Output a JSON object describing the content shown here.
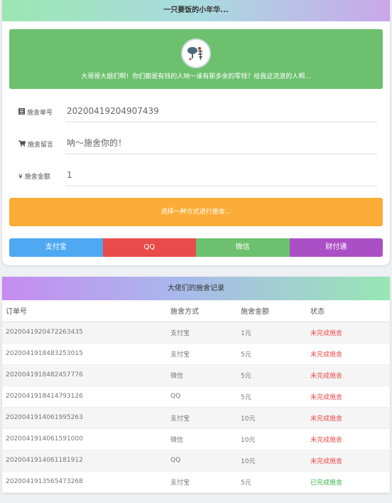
{
  "header": {
    "title": "一只要饭的小年华..."
  },
  "banner": {
    "avatar_icon": "nianhua-logo",
    "text": "大哥哥大姐们啊！你们都是有钱的人呐～谁有那多余的零钱？给我这流浪的人啊..."
  },
  "form": {
    "order": {
      "icon": "list-icon",
      "label": "施舍单号",
      "value": "20200419204907439"
    },
    "message": {
      "icon": "cart-icon",
      "label": "施舍留言",
      "value": "呐～施舍你的！"
    },
    "amount": {
      "icon": "yen-icon",
      "label": "施舍金额",
      "value": "1"
    }
  },
  "action": {
    "label": "选择一种方式进行施舍..."
  },
  "payment_methods": [
    {
      "label": "支付宝",
      "color": "#4fa8f2"
    },
    {
      "label": "QQ",
      "color": "#e94b4b"
    },
    {
      "label": "微信",
      "color": "#6cc06e"
    },
    {
      "label": "财付通",
      "color": "#ab4fc6"
    }
  ],
  "records": {
    "title": "大佬们的施舍记录",
    "columns": [
      "订单号",
      "施舍方式",
      "施舍金额",
      "状态"
    ],
    "rows": [
      {
        "order": "2020041920472263435",
        "method": "支付宝",
        "amount": "1元",
        "status": "未完成施舍",
        "status_color": "#e94b4b"
      },
      {
        "order": "2020041918483253015",
        "method": "支付宝",
        "amount": "5元",
        "status": "未完成施舍",
        "status_color": "#e94b4b"
      },
      {
        "order": "2020041918482457776",
        "method": "微信",
        "amount": "5元",
        "status": "未完成施舍",
        "status_color": "#e94b4b"
      },
      {
        "order": "2020041918414793126",
        "method": "QQ",
        "amount": "5元",
        "status": "未完成施舍",
        "status_color": "#e94b4b"
      },
      {
        "order": "2020041914061995263",
        "method": "支付宝",
        "amount": "10元",
        "status": "未完成施舍",
        "status_color": "#e94b4b"
      },
      {
        "order": "2020041914061591000",
        "method": "微信",
        "amount": "10元",
        "status": "未完成施舍",
        "status_color": "#e94b4b"
      },
      {
        "order": "2020041914061181912",
        "method": "QQ",
        "amount": "10元",
        "status": "未完成施舍",
        "status_color": "#e94b4b"
      },
      {
        "order": "2020041913565473268",
        "method": "支付宝",
        "amount": "5元",
        "status": "已完成施舍",
        "status_color": "#3bb34a"
      }
    ]
  }
}
